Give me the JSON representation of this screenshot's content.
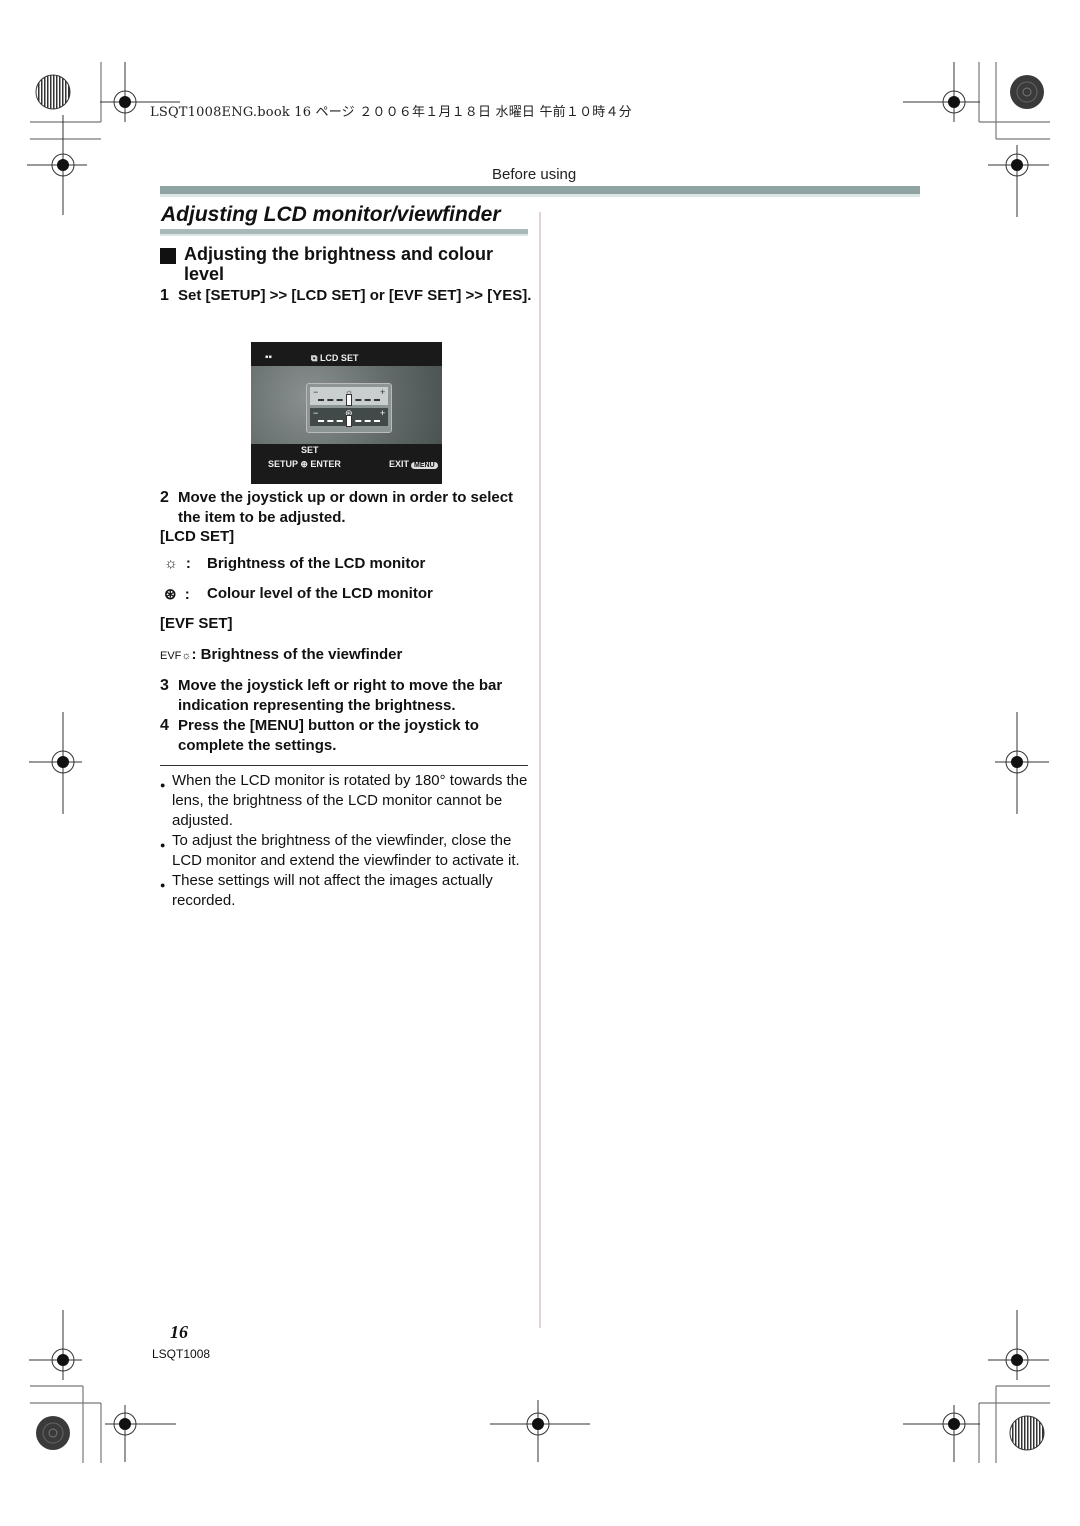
{
  "header": {
    "book_line": "LSQT1008ENG.book  16 ページ  ２００６年１月１８日  水曜日  午前１０時４分",
    "section": "Before using"
  },
  "page_title": "Adjusting LCD monitor/viewfinder",
  "subsection": {
    "title": "Adjusting the brightness and colour level"
  },
  "steps": [
    {
      "num": "1",
      "text": "Set [SETUP] >> [LCD SET] or [EVF SET] >> [YES]."
    },
    {
      "num": "2",
      "text": "Move the joystick up or down in order to select the item to be adjusted."
    },
    {
      "num": "3",
      "text": "Move the joystick left or right to move the bar indication representing the brightness."
    },
    {
      "num": "4",
      "text": "Press the [MENU] button or the joystick to complete the settings."
    }
  ],
  "lcd_screen": {
    "mode_icon": "camera-mode-icon",
    "title": "LCD SET",
    "minus": "−",
    "plus": "+",
    "brightness_level": 0.5,
    "colour_level": 0.5,
    "set_label": "SET",
    "setup_label": "SETUP",
    "enter_label": "ENTER",
    "exit_label": "EXIT",
    "menu_label": "MENU"
  },
  "lcd_set": {
    "label": "[LCD SET]",
    "items": [
      {
        "icon": "brightness-icon",
        "glyph": "☼",
        "text": "Brightness of the LCD monitor"
      },
      {
        "icon": "colour-icon",
        "glyph": "⊛",
        "text": "Colour level of the LCD monitor"
      }
    ]
  },
  "evf_set": {
    "label": "[EVF SET]",
    "items": [
      {
        "icon": "evf-brightness-icon",
        "glyph": "EVF☼",
        "text": "Brightness of the viewfinder"
      }
    ]
  },
  "notes": [
    "When the LCD monitor is rotated by 180° towards the lens, the brightness of the LCD monitor cannot be adjusted.",
    "To adjust the brightness of the viewfinder, close the LCD monitor and extend the viewfinder to activate it.",
    "These settings will not affect the images actually recorded."
  ],
  "bullet": "●",
  "colon": ":",
  "footer": {
    "page_number": "16",
    "code": "LSQT1008"
  }
}
